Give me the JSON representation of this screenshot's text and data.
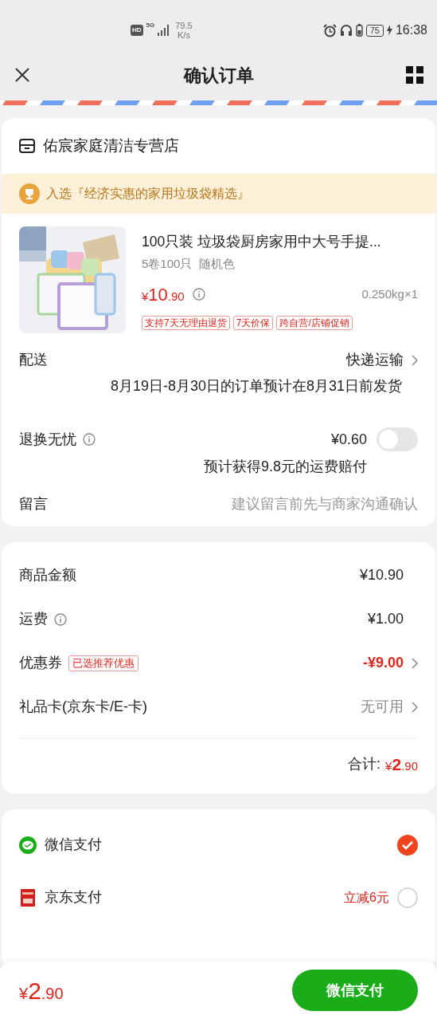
{
  "status_bar": {
    "hd": "HD",
    "network": "5G",
    "speed_value": "79.5",
    "speed_unit": "K/s",
    "battery": "75",
    "time": "16:38"
  },
  "header": {
    "title": "确认订单"
  },
  "store": {
    "name": "佑宸家庭清洁专营店"
  },
  "banner": {
    "text": "入选『经济实惠的家用垃圾袋精选』"
  },
  "product": {
    "title": "100只装 垃圾袋厨房家用中大号手提...",
    "spec": "5卷100只  随机色",
    "price": {
      "currency": "¥",
      "integer": "10",
      "decimal": ".90"
    },
    "weight": "0.250kg×1",
    "tags": [
      "支持7天无理由退货",
      "7天价保",
      "跨自营/店铺促销"
    ]
  },
  "delivery": {
    "label": "配送",
    "method": "快递运输",
    "note": "8月19日-8月30日的订单预计在8月31日前发货"
  },
  "return_insurance": {
    "label": "退换无忧",
    "price": "¥0.60",
    "on": false,
    "note": "预计获得9.8元的运费赔付"
  },
  "message": {
    "label": "留言",
    "placeholder": "建议留言前先与商家沟通确认"
  },
  "summary": [
    {
      "label": "商品金额",
      "value": "¥10.90",
      "info": false,
      "kind": "plain"
    },
    {
      "label": "运费",
      "value": "¥1.00",
      "info": true,
      "kind": "plain"
    },
    {
      "label": "优惠券",
      "value": "-¥9.00",
      "badge": "已选推荐优惠",
      "info": false,
      "kind": "discount"
    },
    {
      "label": "礼品卡(京东卡/E-卡)",
      "value": "无可用",
      "info": false,
      "kind": "muted"
    }
  ],
  "total": {
    "label": "合计:",
    "price": {
      "currency": "¥",
      "integer": "2",
      "decimal": ".90"
    }
  },
  "payments": [
    {
      "name": "微信支付",
      "kind": "wechat",
      "selected": true
    },
    {
      "name": "京东支付",
      "kind": "jd",
      "promo": "立减6元",
      "selected": false
    }
  ],
  "footer": {
    "price": {
      "currency": "¥",
      "integer": "2",
      "decimal": ".90"
    },
    "button": "微信支付"
  }
}
